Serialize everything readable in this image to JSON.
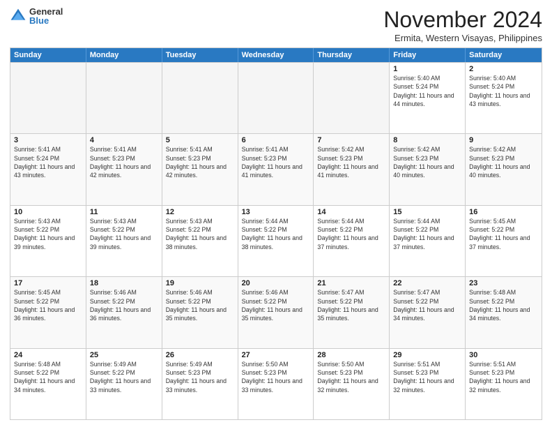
{
  "logo": {
    "general": "General",
    "blue": "Blue"
  },
  "title": "November 2024",
  "location": "Ermita, Western Visayas, Philippines",
  "days_of_week": [
    "Sunday",
    "Monday",
    "Tuesday",
    "Wednesday",
    "Thursday",
    "Friday",
    "Saturday"
  ],
  "rows": [
    [
      {
        "day": "",
        "empty": true
      },
      {
        "day": "",
        "empty": true
      },
      {
        "day": "",
        "empty": true
      },
      {
        "day": "",
        "empty": true
      },
      {
        "day": "",
        "empty": true
      },
      {
        "day": "1",
        "sunrise": "5:40 AM",
        "sunset": "5:24 PM",
        "daylight": "11 hours and 44 minutes."
      },
      {
        "day": "2",
        "sunrise": "5:40 AM",
        "sunset": "5:24 PM",
        "daylight": "11 hours and 43 minutes."
      }
    ],
    [
      {
        "day": "3",
        "sunrise": "5:41 AM",
        "sunset": "5:24 PM",
        "daylight": "11 hours and 43 minutes."
      },
      {
        "day": "4",
        "sunrise": "5:41 AM",
        "sunset": "5:23 PM",
        "daylight": "11 hours and 42 minutes."
      },
      {
        "day": "5",
        "sunrise": "5:41 AM",
        "sunset": "5:23 PM",
        "daylight": "11 hours and 42 minutes."
      },
      {
        "day": "6",
        "sunrise": "5:41 AM",
        "sunset": "5:23 PM",
        "daylight": "11 hours and 41 minutes."
      },
      {
        "day": "7",
        "sunrise": "5:42 AM",
        "sunset": "5:23 PM",
        "daylight": "11 hours and 41 minutes."
      },
      {
        "day": "8",
        "sunrise": "5:42 AM",
        "sunset": "5:23 PM",
        "daylight": "11 hours and 40 minutes."
      },
      {
        "day": "9",
        "sunrise": "5:42 AM",
        "sunset": "5:23 PM",
        "daylight": "11 hours and 40 minutes."
      }
    ],
    [
      {
        "day": "10",
        "sunrise": "5:43 AM",
        "sunset": "5:22 PM",
        "daylight": "11 hours and 39 minutes."
      },
      {
        "day": "11",
        "sunrise": "5:43 AM",
        "sunset": "5:22 PM",
        "daylight": "11 hours and 39 minutes."
      },
      {
        "day": "12",
        "sunrise": "5:43 AM",
        "sunset": "5:22 PM",
        "daylight": "11 hours and 38 minutes."
      },
      {
        "day": "13",
        "sunrise": "5:44 AM",
        "sunset": "5:22 PM",
        "daylight": "11 hours and 38 minutes."
      },
      {
        "day": "14",
        "sunrise": "5:44 AM",
        "sunset": "5:22 PM",
        "daylight": "11 hours and 37 minutes."
      },
      {
        "day": "15",
        "sunrise": "5:44 AM",
        "sunset": "5:22 PM",
        "daylight": "11 hours and 37 minutes."
      },
      {
        "day": "16",
        "sunrise": "5:45 AM",
        "sunset": "5:22 PM",
        "daylight": "11 hours and 37 minutes."
      }
    ],
    [
      {
        "day": "17",
        "sunrise": "5:45 AM",
        "sunset": "5:22 PM",
        "daylight": "11 hours and 36 minutes."
      },
      {
        "day": "18",
        "sunrise": "5:46 AM",
        "sunset": "5:22 PM",
        "daylight": "11 hours and 36 minutes."
      },
      {
        "day": "19",
        "sunrise": "5:46 AM",
        "sunset": "5:22 PM",
        "daylight": "11 hours and 35 minutes."
      },
      {
        "day": "20",
        "sunrise": "5:46 AM",
        "sunset": "5:22 PM",
        "daylight": "11 hours and 35 minutes."
      },
      {
        "day": "21",
        "sunrise": "5:47 AM",
        "sunset": "5:22 PM",
        "daylight": "11 hours and 35 minutes."
      },
      {
        "day": "22",
        "sunrise": "5:47 AM",
        "sunset": "5:22 PM",
        "daylight": "11 hours and 34 minutes."
      },
      {
        "day": "23",
        "sunrise": "5:48 AM",
        "sunset": "5:22 PM",
        "daylight": "11 hours and 34 minutes."
      }
    ],
    [
      {
        "day": "24",
        "sunrise": "5:48 AM",
        "sunset": "5:22 PM",
        "daylight": "11 hours and 34 minutes."
      },
      {
        "day": "25",
        "sunrise": "5:49 AM",
        "sunset": "5:22 PM",
        "daylight": "11 hours and 33 minutes."
      },
      {
        "day": "26",
        "sunrise": "5:49 AM",
        "sunset": "5:23 PM",
        "daylight": "11 hours and 33 minutes."
      },
      {
        "day": "27",
        "sunrise": "5:50 AM",
        "sunset": "5:23 PM",
        "daylight": "11 hours and 33 minutes."
      },
      {
        "day": "28",
        "sunrise": "5:50 AM",
        "sunset": "5:23 PM",
        "daylight": "11 hours and 32 minutes."
      },
      {
        "day": "29",
        "sunrise": "5:51 AM",
        "sunset": "5:23 PM",
        "daylight": "11 hours and 32 minutes."
      },
      {
        "day": "30",
        "sunrise": "5:51 AM",
        "sunset": "5:23 PM",
        "daylight": "11 hours and 32 minutes."
      }
    ]
  ]
}
